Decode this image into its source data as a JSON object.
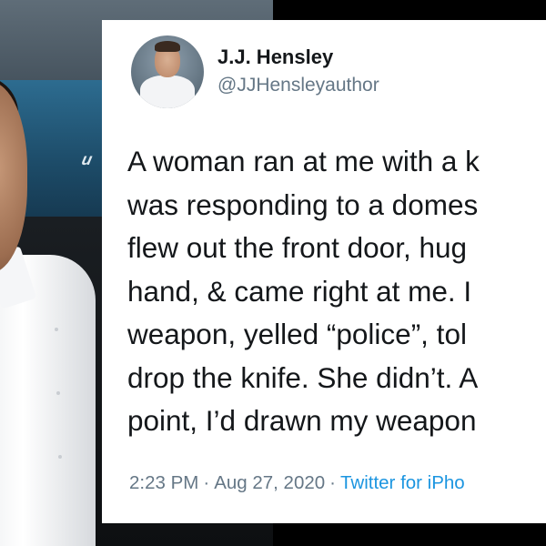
{
  "photo": {
    "board_logo": "u"
  },
  "tweet": {
    "author_name": "J.J. Hensley",
    "author_handle": "@JJHensleyauthor",
    "lines": [
      "A woman ran at me with a k",
      "was responding to a domes",
      "flew out the front door, hug",
      "hand, & came right at me. I",
      "weapon, yelled “police”, tol",
      "drop the knife. She didn’t. A",
      "point, I’d drawn my weapon"
    ],
    "time": "2:23 PM",
    "separator": "·",
    "date": "Aug 27, 2020",
    "source": "Twitter for iPho"
  },
  "colors": {
    "text_primary": "#14171a",
    "text_secondary": "#657786",
    "link_blue": "#1b95e0"
  }
}
